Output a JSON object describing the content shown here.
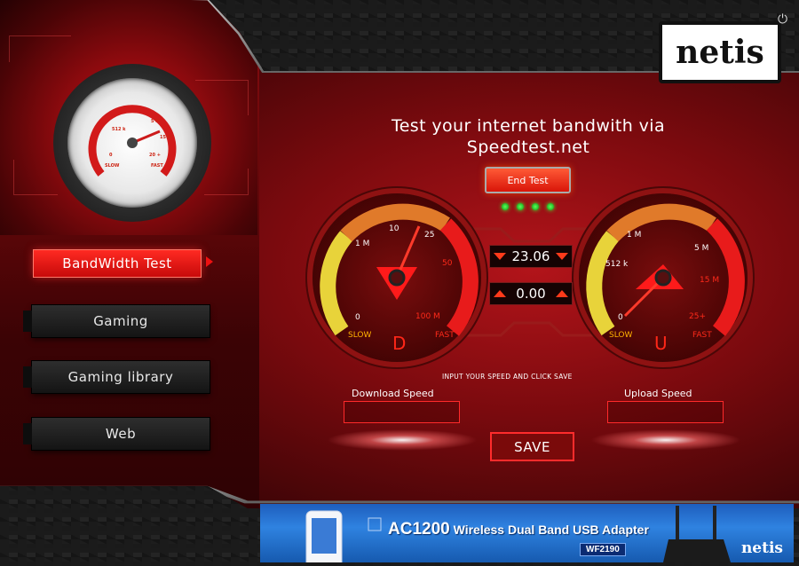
{
  "app": {
    "brand": "netis",
    "headline_line1": "Test your internet bandwith via",
    "headline_line2": "Speedtest.net",
    "end_test_label": "End Test"
  },
  "nav": [
    {
      "label": "BandWidth Test",
      "active": true
    },
    {
      "label": "Gaming",
      "active": false
    },
    {
      "label": "Gaming library",
      "active": false
    },
    {
      "label": "Web",
      "active": false
    }
  ],
  "small_gauge": {
    "labels": [
      "512 k",
      "5 M",
      "15 M",
      "20 +",
      "0",
      "SLOW",
      "FAST"
    ]
  },
  "download_gauge": {
    "letter": "D",
    "ticks": [
      "0",
      "1 M",
      "10",
      "25",
      "50",
      "100 M"
    ],
    "slow": "SLOW",
    "fast": "FAST"
  },
  "upload_gauge": {
    "letter": "U",
    "ticks": [
      "0",
      "512 k",
      "1 M",
      "5 M",
      "15 M",
      "25+"
    ],
    "slow": "SLOW",
    "fast": "FAST"
  },
  "speeds": {
    "download_value": "23.06",
    "upload_value": "0.00"
  },
  "form": {
    "instruction": "INPUT YOUR SPEED AND CLICK SAVE",
    "download_label": "Download Speed",
    "upload_label": "Upload Speed",
    "download_value": "",
    "upload_value": "",
    "save_label": "SAVE"
  },
  "banner": {
    "title_big": "AC1200",
    "title_rest": " Wireless Dual Band USB Adapter",
    "model": "WF2190",
    "brand": "netis"
  },
  "icons": {
    "power": "power-icon"
  }
}
